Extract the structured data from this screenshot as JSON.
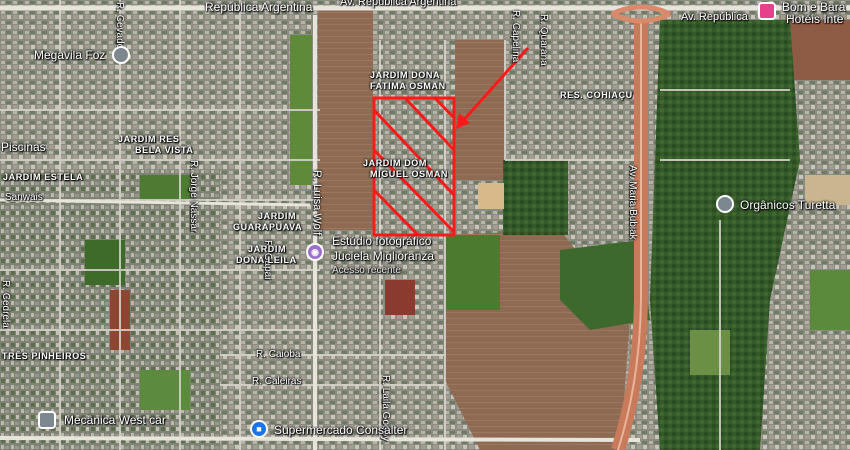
{
  "map": {
    "streets": {
      "republica_argentina_left": "República Argentina",
      "av_republica_argentina": "Av. República Argentina",
      "av_republica_right": "Av. República",
      "r_cevado": "R. Cevado",
      "r_capelina": "R. Capelina",
      "r_quarana": "R. Quarana",
      "r_luisa": "R. Luisa Wolf",
      "r_jorge_nassar": "R. Jorge Nassar",
      "sanwais": "Sanwais",
      "r_caioba": "R. Caioba",
      "r_caleiras": "R. Caleiras",
      "r_laila": "R. Laila Godoy",
      "av_maria_bubiak": "Av. Maria Bubiak",
      "r_cedrela": "R. Cedrela",
      "r_gapai": "R. Gapai"
    },
    "neighborhoods": {
      "dona_fatima_1": "JARDIM DONA",
      "dona_fatima_2": "FATIMA OSMAN",
      "res_cohiacu": "RES. COHIAÇU",
      "bela_vista_1": "JARDIM RES",
      "bela_vista_2": "BELA VISTA",
      "dom_miguel_1": "JARDIM DOM",
      "dom_miguel_2": "MIGUEL OSMAN",
      "estela": "JARDIM ESTELA",
      "guarapuava_1": "JARDIM",
      "guarapuava_2": "GUARAPUAVA",
      "dona_leila_1": "JARDIM",
      "dona_leila_2": "DONA LEILA",
      "tres_pinheiros": "TRÊS PINHEIROS"
    },
    "pois": {
      "megavila": "Megavila Foz",
      "piscinas": "Piscinas",
      "bom_bara": "Bom e Bara",
      "hoteis": "Hotéis Inte",
      "organicos": "Orgânicos Turetta",
      "estudio_1": "Estúdio fotográfico",
      "estudio_2": "Juciela Miglioranza",
      "estudio_sub": "Acesso recente",
      "mecanica": "Mecânica West car",
      "supermercado": "Supermercado Consalter"
    },
    "colors": {
      "highlight": "#ff1a1a",
      "pin_gray": "#7d8790",
      "pin_purple": "#9b6fcf",
      "pin_pink": "#e8408b",
      "pin_blue": "#1a73e8",
      "highway": "#c87a5a"
    }
  }
}
